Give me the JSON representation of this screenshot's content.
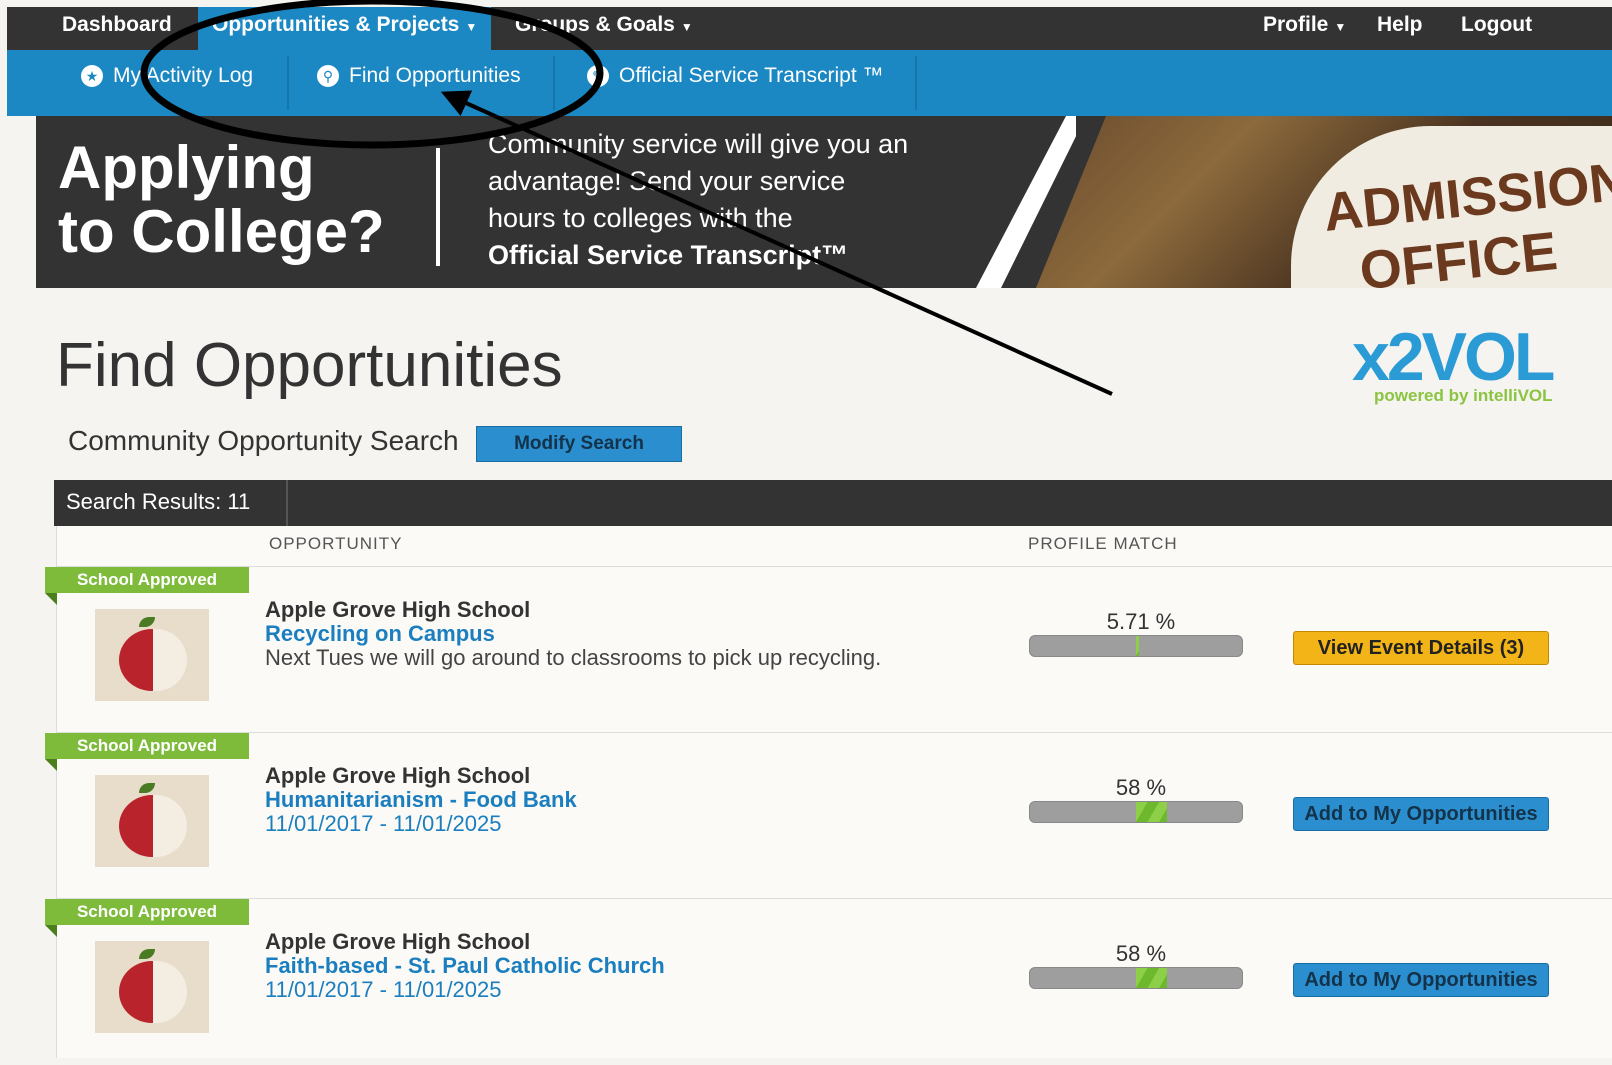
{
  "nav": {
    "dashboard": "Dashboard",
    "opportunities": "Opportunities & Projects",
    "groups": "Groups & Goals",
    "profile": "Profile",
    "help": "Help",
    "logout": "Logout"
  },
  "subnav": {
    "activity_log": "My Activity Log",
    "find_opps": "Find Opportunities",
    "transcript": "Official Service Transcript ™"
  },
  "banner": {
    "title_line1": "Applying",
    "title_line2": "to College?",
    "desc_line1": "Community service will give you an",
    "desc_line2": "advantage! Send your service",
    "desc_line3": "hours to colleges with the",
    "desc_bold": "Official Service Transcript™",
    "sign_line1": "ADMISSIONS",
    "sign_line2": "OFFICE"
  },
  "page_title": "Find Opportunities",
  "logo": {
    "main": "x2VOL",
    "sub": "powered by intelliVOL"
  },
  "search": {
    "label": "Community Opportunity Search",
    "modify_button": "Modify Search"
  },
  "results": {
    "label": "Search Results: 11",
    "col_opportunity": "OPPORTUNITY",
    "col_match": "PROFILE MATCH",
    "rows": [
      {
        "badge": "School Approved",
        "org": "Apple Grove High School",
        "title": "Recycling on Campus",
        "detail": "Next Tues we will go around to classrooms to pick up recycling.",
        "match_label": "5.71 %",
        "match_value": 5.71,
        "button": "View Event Details (3)"
      },
      {
        "badge": "School Approved",
        "org": "Apple Grove High School",
        "title": "Humanitarianism - Food Bank",
        "detail": "11/01/2017 - 11/01/2025",
        "match_label": "58 %",
        "match_value": 58,
        "button": "Add to My Opportunities"
      },
      {
        "badge": "School Approved",
        "org": "Apple Grove High School",
        "title": "Faith-based - St. Paul Catholic Church",
        "detail": "11/01/2017 - 11/01/2025",
        "match_label": "58 %",
        "match_value": 58,
        "button": "Add to My Opportunities"
      }
    ]
  }
}
